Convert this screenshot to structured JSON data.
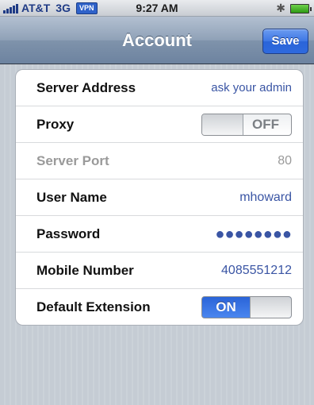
{
  "status_bar": {
    "carrier": "AT&T",
    "network": "3G",
    "vpn_label": "VPN",
    "time": "9:27 AM",
    "bluetooth_icon": "bluetooth-icon",
    "battery_icon": "battery-charging-icon"
  },
  "nav": {
    "title": "Account",
    "save_label": "Save"
  },
  "settings": {
    "server_address": {
      "label": "Server Address",
      "value": "ask your admin"
    },
    "proxy": {
      "label": "Proxy",
      "state": "OFF"
    },
    "server_port": {
      "label": "Server Port",
      "value": "80"
    },
    "user_name": {
      "label": "User Name",
      "value": "mhoward"
    },
    "password": {
      "label": "Password",
      "value": "●●●●●●●●"
    },
    "mobile_number": {
      "label": "Mobile Number",
      "value": "4085551212"
    },
    "default_extension": {
      "label": "Default Extension",
      "state": "ON"
    }
  },
  "colors": {
    "value_text": "#3a55a4",
    "switch_on": "#2a64d8",
    "nav_bar": "#7f93ab"
  }
}
